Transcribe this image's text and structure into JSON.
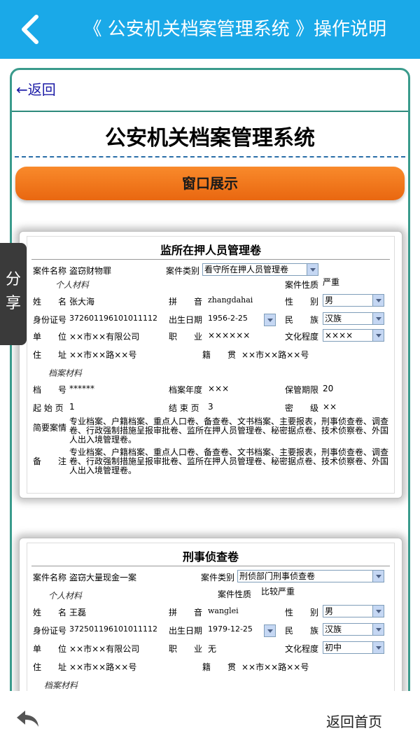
{
  "header": {
    "title": "《 公安机关档案管理系统 》操作说明"
  },
  "nav": {
    "return_link": "←返回",
    "doc_title": "公安机关档案管理系统",
    "section_button": "窗口展示"
  },
  "share_label": "分享",
  "card1": {
    "title": "监所在押人员管理卷",
    "case_name_label": "案件名称",
    "case_name": "盗窃财物罪",
    "case_type_label": "案件类别",
    "case_type": "看守所在押人员管理卷",
    "personal_section": "个人材料",
    "case_nature_label": "案件性质",
    "case_nature": "严重",
    "name_label": "姓　　名",
    "name": "张大海",
    "pinyin_label": "拼　　音",
    "pinyin": "zhangdahai",
    "gender_label": "性　　别",
    "gender": "男",
    "id_label": "身份证号",
    "id": "372601196101011112",
    "birth_label": "出生日期",
    "birth": "1956-2-25",
    "ethnic_label": "民　　族",
    "ethnic": "汉族",
    "unit_label": "单　　位",
    "unit": "××市××有限公司",
    "job_label": "职　　业",
    "job": "××××××",
    "edu_label": "文化程度",
    "edu": "××××",
    "addr_label": "住　　址",
    "addr": "××市××路××号",
    "native_label": "籍　　贯",
    "native": "××市××路××号",
    "archive_section": "档案材料",
    "file_no_label": "档　　号",
    "file_no": "******",
    "year_label": "档案年度",
    "year": "×××",
    "keep_label": "保管期限",
    "keep": "20",
    "start_label": "起 始 页",
    "start": "1",
    "end_label": "结 束 页",
    "end": "3",
    "secret_label": "密　　级",
    "secret": "××",
    "summary_label": "简要案情",
    "summary": "专业档案、户籍档案、重点人口卷、备查卷、文书档案、主要报表，刑事侦查卷、调查卷、行政强制措施呈报审批卷、监所在押人员管理卷、秘密据点卷、技术侦察卷、外国人出入境管理卷。",
    "remark_label": "备　　注",
    "remark": "专业档案、户籍档案、重点人口卷、备查卷、文书档案、主要报表，刑事侦查卷、调查卷、行政强制措施呈报审批卷、监所在押人员管理卷、秘密据点卷、技术侦察卷、外国人出入境管理卷。"
  },
  "card2": {
    "title": "刑事侦查卷",
    "case_name_label": "案件名称",
    "case_name": "盗窃大量现金一案",
    "case_type_label": "案件类别",
    "case_type": "刑侦部门刑事侦查卷",
    "personal_section": "个人材料",
    "case_nature_label": "案件性质",
    "case_nature": "比较严重",
    "name_label": "姓　　名",
    "name": "王磊",
    "pinyin_label": "拼　　音",
    "pinyin": "wanglei",
    "gender_label": "性　　别",
    "gender": "男",
    "id_label": "身份证号",
    "id": "372501196101011112",
    "birth_label": "出生日期",
    "birth": "1979-12-25",
    "ethnic_label": "民　　族",
    "ethnic": "汉族",
    "unit_label": "单　　位",
    "unit": "××市××有限公司",
    "job_label": "职　　业",
    "job": "无",
    "edu_label": "文化程度",
    "edu": "初中",
    "addr_label": "住　　址",
    "addr": "××市××路××号",
    "native_label": "籍　　贯",
    "native": "××市××路××号",
    "archive_section": "档案材料"
  },
  "footer": {
    "home_label": "返回首页"
  }
}
